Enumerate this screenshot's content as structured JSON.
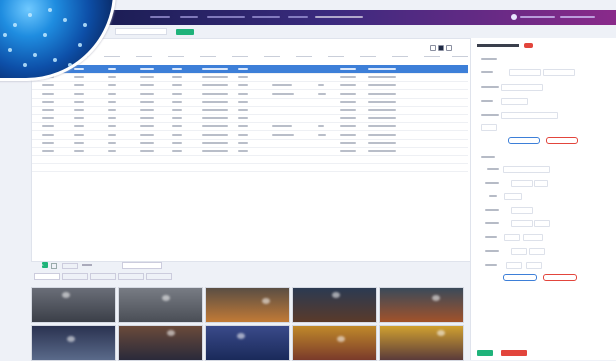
{
  "header": {
    "nav_items": [
      "",
      "",
      "",
      "",
      "",
      ""
    ]
  },
  "filter": {
    "value": "",
    "search_label": ""
  },
  "table": {
    "headers": [
      "",
      "",
      "",
      "",
      "",
      "",
      "",
      "",
      "",
      "",
      "",
      "",
      "",
      ""
    ],
    "selected_index": 0,
    "row_count": 13
  },
  "pager": {
    "page": "1",
    "size_label": ""
  },
  "file_tabs": [
    "",
    "",
    "",
    "",
    ""
  ],
  "thumbnails": [
    {
      "name": "thumb-1",
      "top": "#6a6e78",
      "bottom": "#3b3f48"
    },
    {
      "name": "thumb-2",
      "top": "#787c84",
      "bottom": "#4a4e56"
    },
    {
      "name": "thumb-3",
      "top": "#5a4e44",
      "bottom": "#c27a36"
    },
    {
      "name": "thumb-4",
      "top": "#2b3a52",
      "bottom": "#5a3a2a"
    },
    {
      "name": "thumb-5",
      "top": "#3a4a5a",
      "bottom": "#a2522a"
    },
    {
      "name": "thumb-6",
      "top": "#2a3250",
      "bottom": "#5a6a8a"
    },
    {
      "name": "thumb-7",
      "top": "#6a4a3a",
      "bottom": "#2a2a3a"
    },
    {
      "name": "thumb-8",
      "top": "#3a4a8a",
      "bottom": "#1a2a5a"
    },
    {
      "name": "thumb-9",
      "top": "#c0892a",
      "bottom": "#7a3a2a"
    },
    {
      "name": "thumb-10",
      "top": "#d0a030",
      "bottom": "#5a3a3a"
    }
  ],
  "side": {
    "title": "",
    "badge": "",
    "save_label": "",
    "delete_label": ""
  },
  "colors": {
    "accent": "#3d7fd8",
    "green": "#1fb37a",
    "red": "#e2453c",
    "topbar_start": "#1a1d52",
    "topbar_end": "#8a2a8a"
  }
}
